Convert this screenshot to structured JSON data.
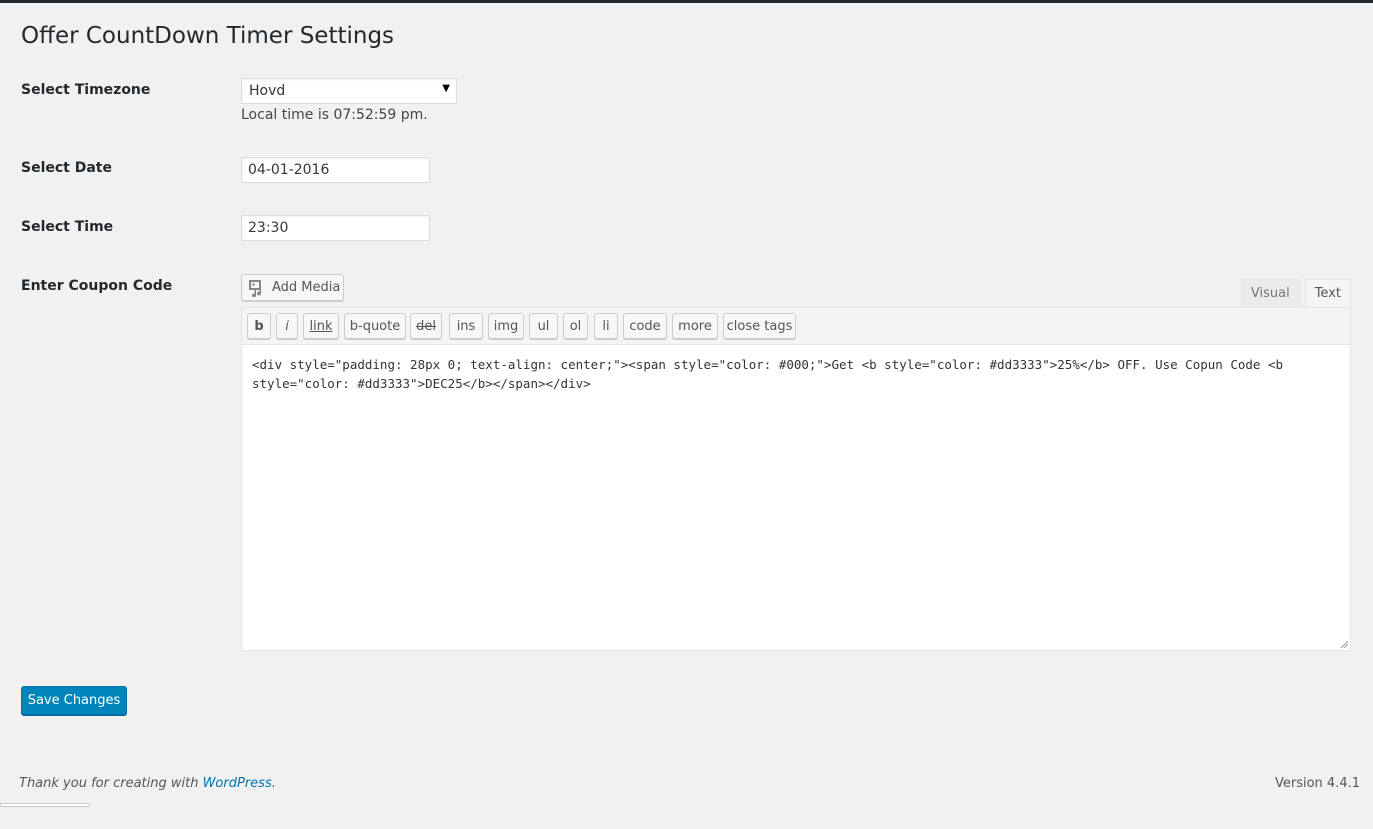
{
  "page": {
    "title": "Offer CountDown Timer Settings"
  },
  "form": {
    "timezone": {
      "label": "Select Timezone",
      "selected": "Hovd",
      "local_time_note": "Local time is 07:52:59 pm."
    },
    "date": {
      "label": "Select Date",
      "value": "04-01-2016"
    },
    "time": {
      "label": "Select Time",
      "value": "23:30"
    },
    "coupon": {
      "label": "Enter Coupon Code",
      "add_media_label": "Add Media",
      "tabs": {
        "visual": "Visual",
        "text": "Text"
      },
      "quicktags": [
        "b",
        "i",
        "link",
        "b-quote",
        "del",
        "ins",
        "img",
        "ul",
        "ol",
        "li",
        "code",
        "more",
        "close tags"
      ],
      "content": "<div style=\"padding: 28px 0; text-align: center;\"><span style=\"color: #000;\">Get <b style=\"color: #dd3333\">25%</b> OFF. Use Copun Code <b style=\"color: #dd3333\">DEC25</b></span></div>"
    }
  },
  "actions": {
    "save_label": "Save Changes"
  },
  "footer": {
    "thanks_prefix": "Thank you for creating with ",
    "wp_link": "WordPress",
    "thanks_suffix": ".",
    "version": "Version 4.4.1"
  },
  "colors": {
    "primary_button": "#0085ba",
    "link": "#0073aa",
    "background": "#f1f1f1"
  }
}
